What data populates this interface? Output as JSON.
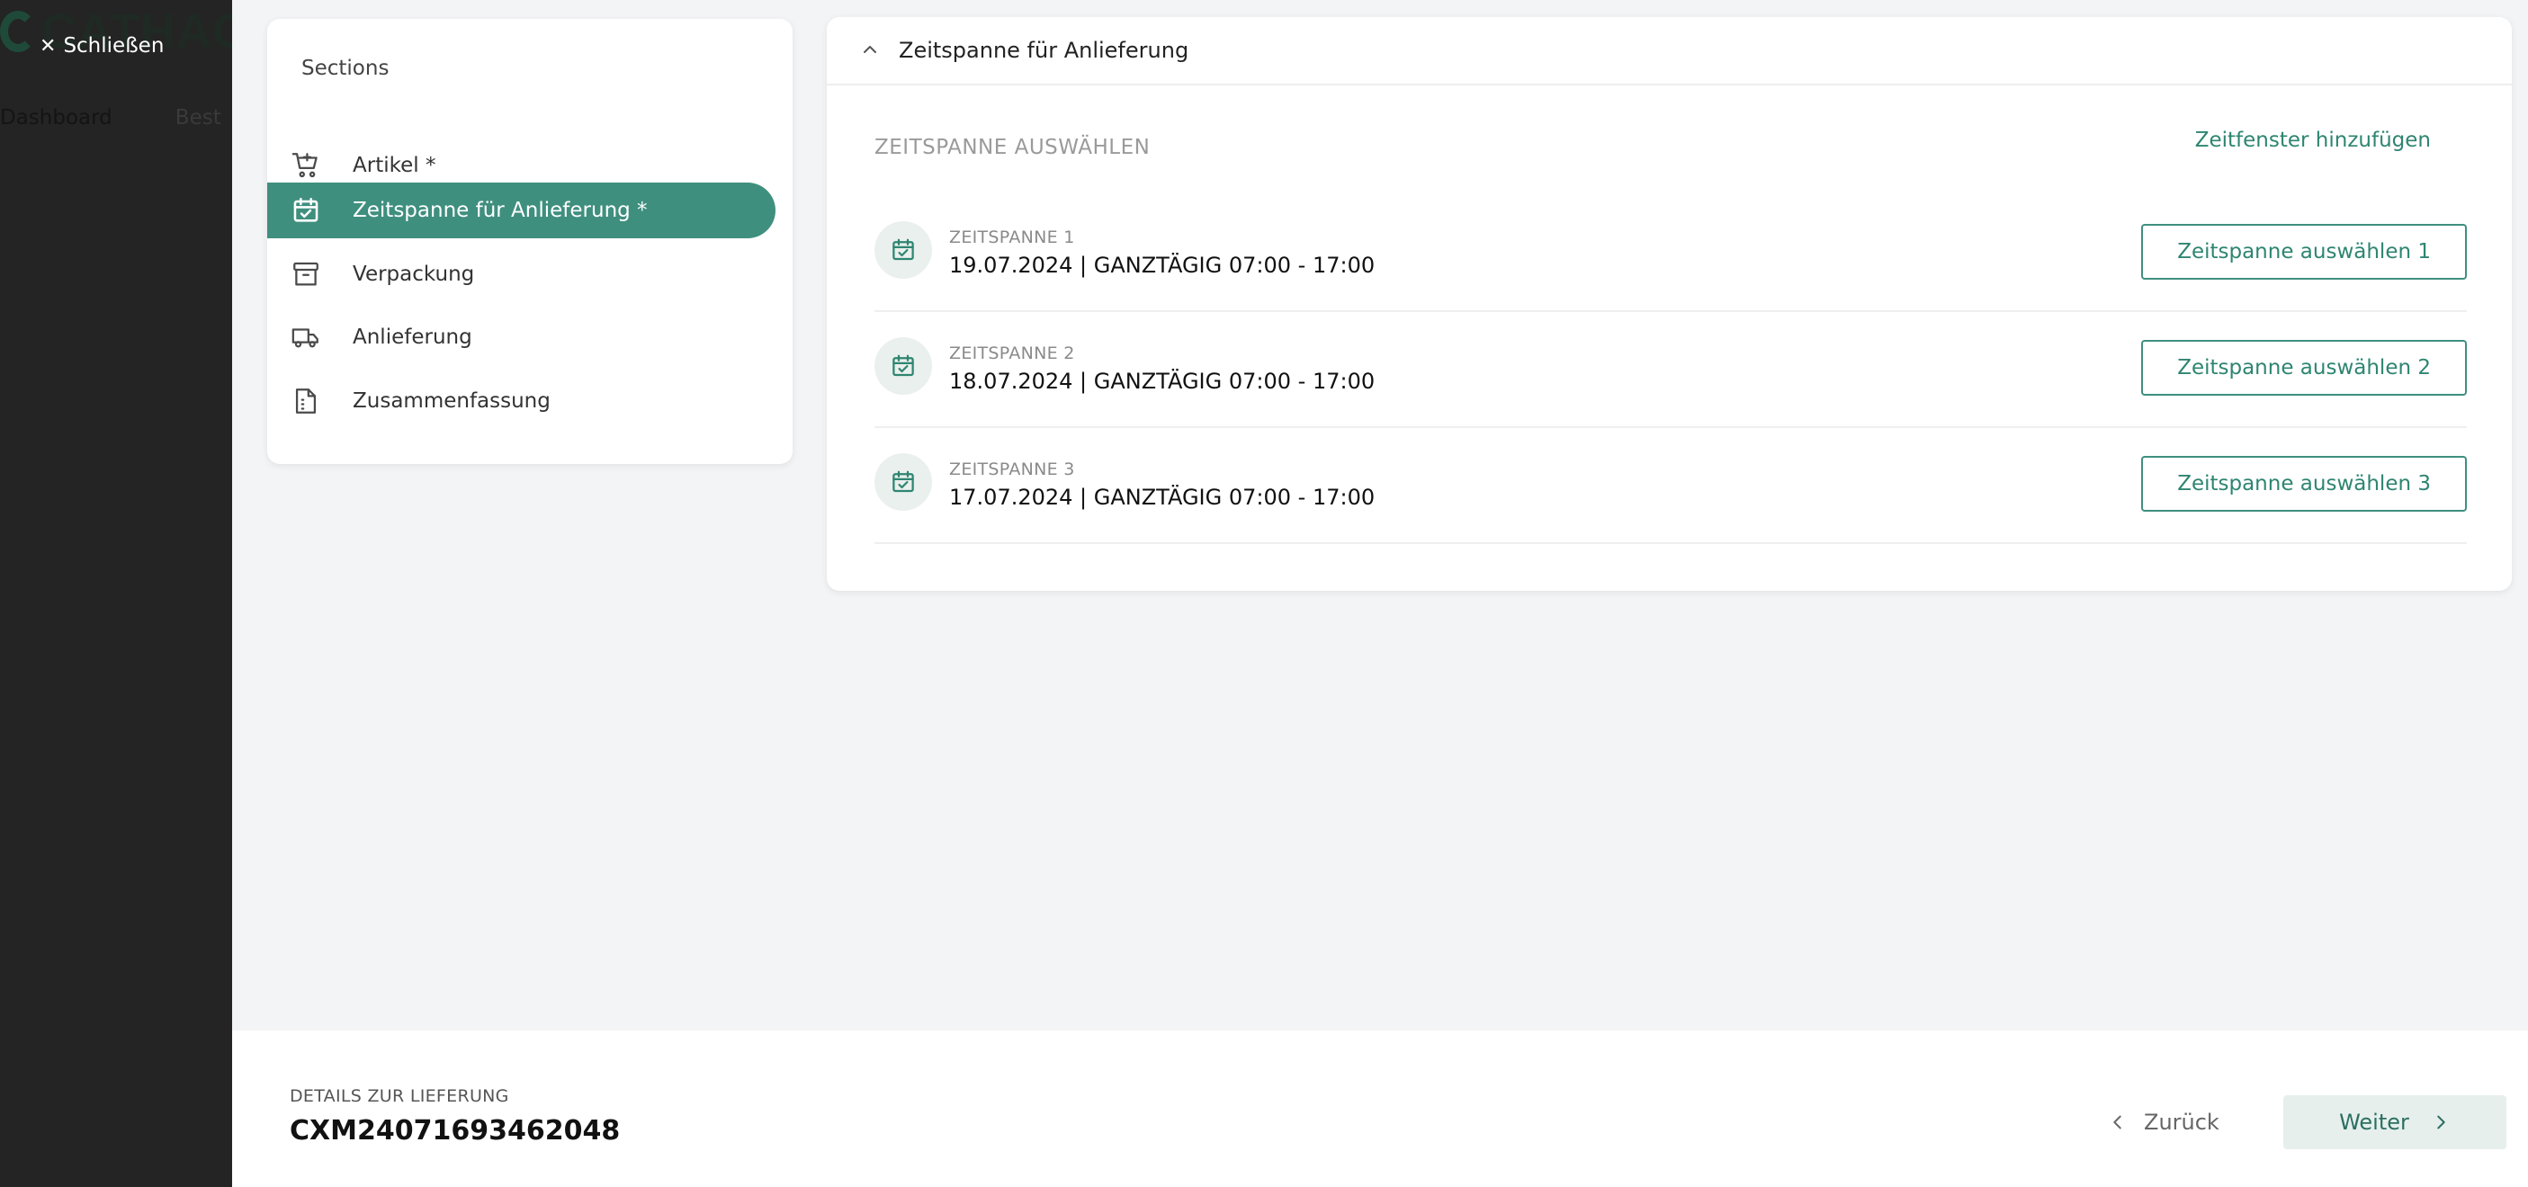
{
  "background_app": {
    "logo_text": "CATHAG",
    "close_label": "Schließen",
    "nav_items": [
      "Dashboard",
      "Best"
    ]
  },
  "sections": {
    "title": "Sections",
    "items": [
      {
        "label": "Artikel *",
        "icon": "cart-add-icon",
        "active": false
      },
      {
        "label": "Zeitspanne für Anlieferung *",
        "icon": "calendar-check-icon",
        "active": true
      },
      {
        "label": "Verpackung",
        "icon": "archive-box-icon",
        "active": false
      },
      {
        "label": "Anlieferung",
        "icon": "truck-icon",
        "active": false
      },
      {
        "label": "Zusammenfassung",
        "icon": "document-icon",
        "active": false
      }
    ]
  },
  "panel": {
    "title": "Zeitspanne für Anlieferung",
    "select_label": "ZEITSPANNE AUSWÄHLEN",
    "add_window_label": "Zeitfenster hinzufügen",
    "slots": [
      {
        "caption": "ZEITSPANNE 1",
        "value": "19.07.2024 | GANZTÄGIG 07:00 - 17:00",
        "button": "Zeitspanne auswählen 1"
      },
      {
        "caption": "ZEITSPANNE 2",
        "value": "18.07.2024 | GANZTÄGIG 07:00 - 17:00",
        "button": "Zeitspanne auswählen 2"
      },
      {
        "caption": "ZEITSPANNE 3",
        "value": "17.07.2024 | GANZTÄGIG 07:00 - 17:00",
        "button": "Zeitspanne auswählen 3"
      }
    ]
  },
  "footer": {
    "label": "DETAILS ZUR LIEFERUNG",
    "delivery_id": "CXM24071693462048",
    "back_label": "Zurück",
    "next_label": "Weiter"
  },
  "colors": {
    "accent": "#3f8f7f",
    "accent_text": "#2e8571",
    "overlay": "#242424",
    "page_bg": "#f3f4f6"
  }
}
